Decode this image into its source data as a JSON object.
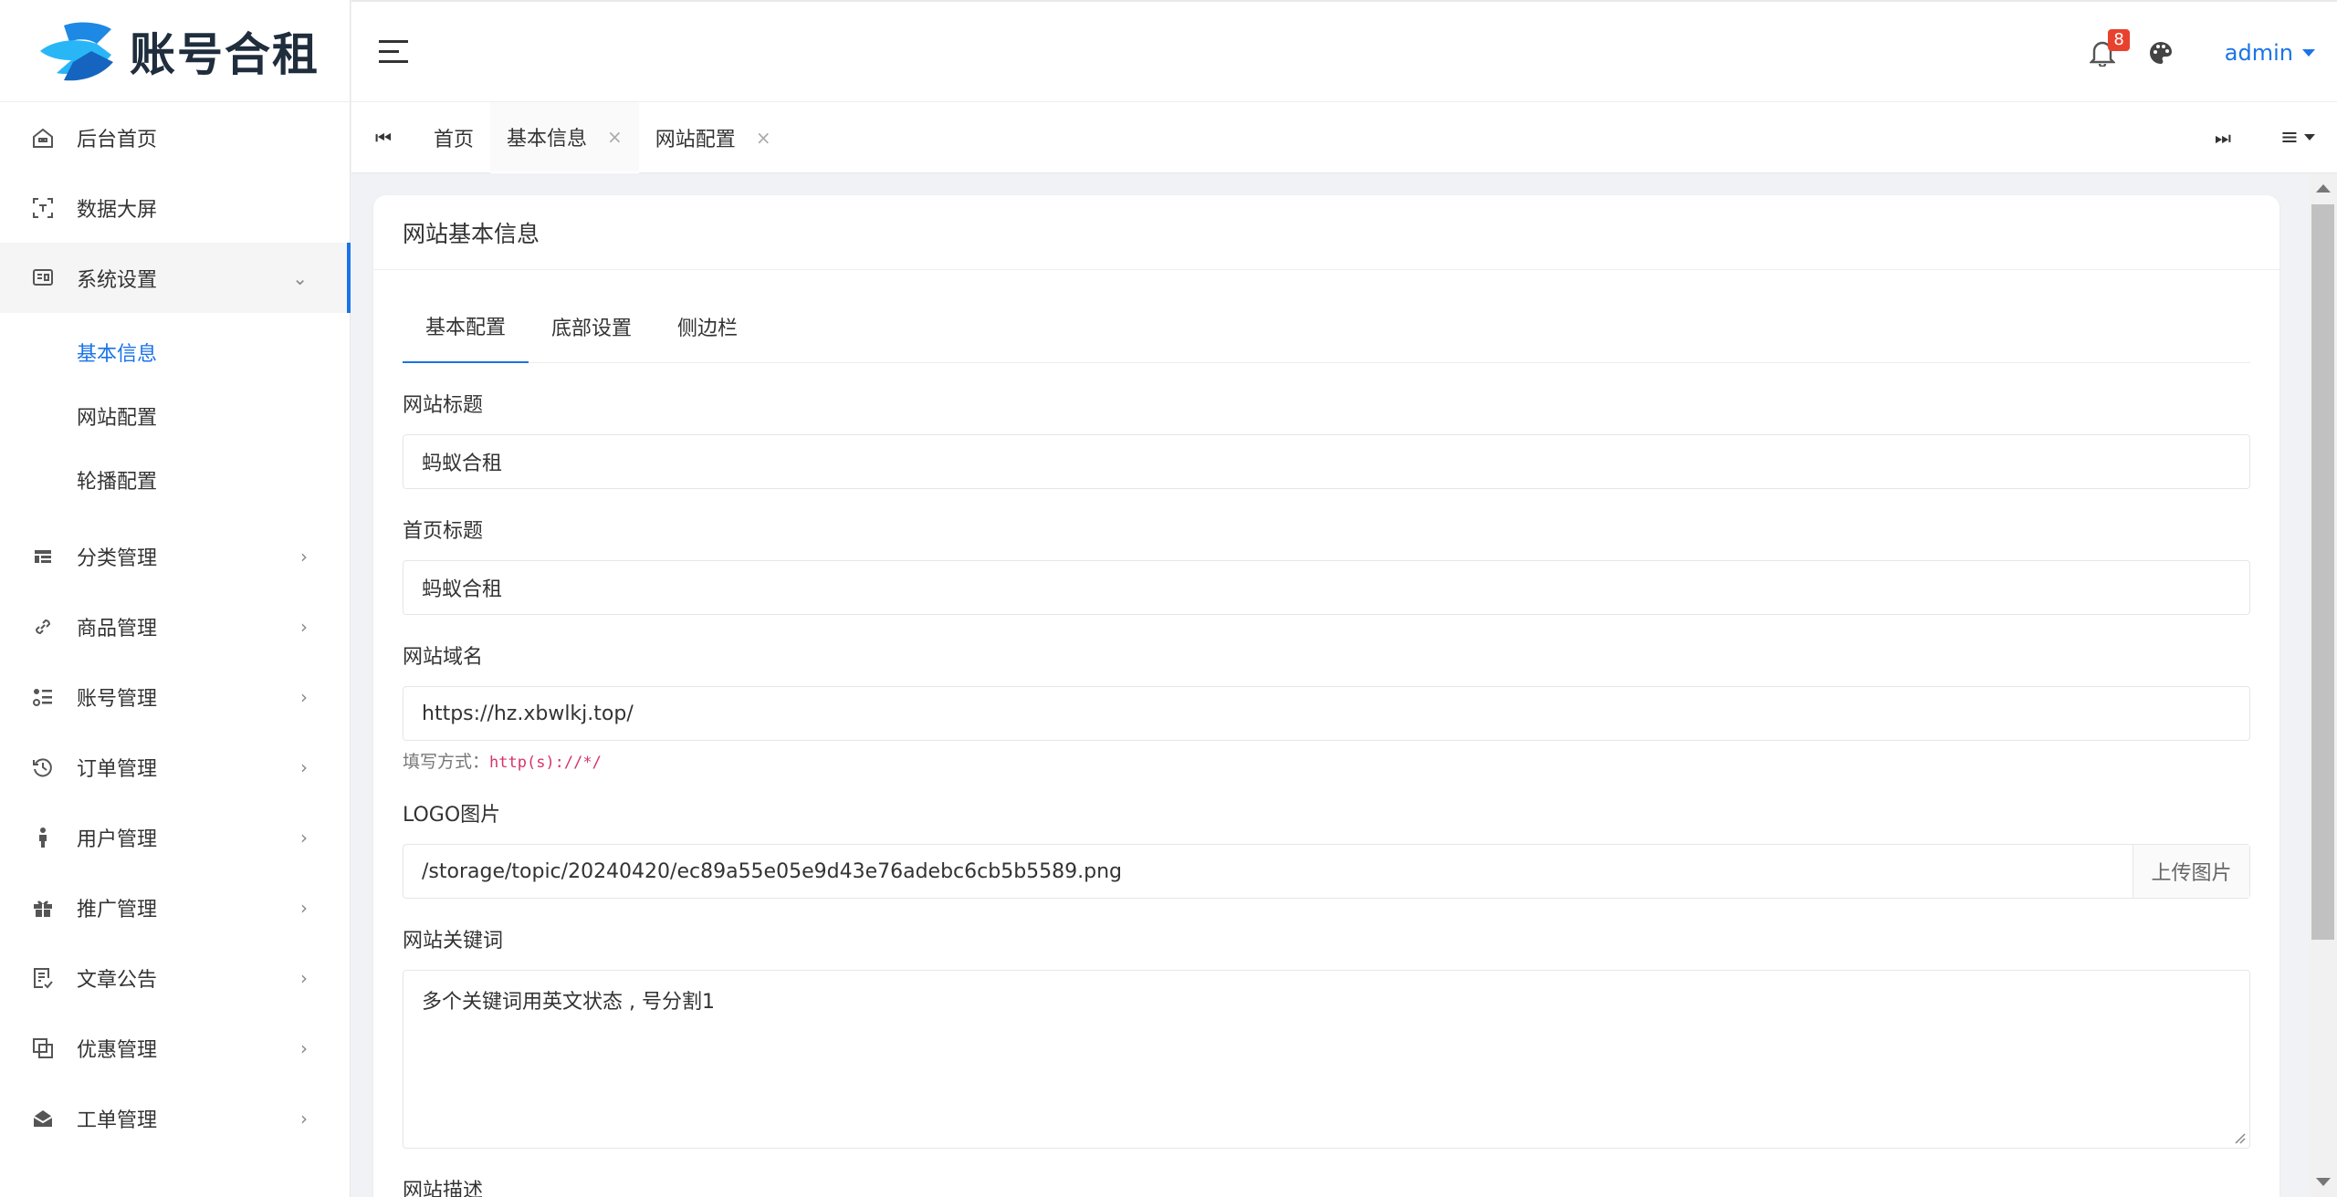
{
  "brand": {
    "name": "账号合租"
  },
  "sidebar": {
    "items": [
      {
        "label": "后台首页",
        "icon": "home-icon"
      },
      {
        "label": "数据大屏",
        "icon": "screen-icon"
      },
      {
        "label": "系统设置",
        "icon": "settings-icon",
        "expanded": true,
        "children": [
          {
            "label": "基本信息",
            "selected": true
          },
          {
            "label": "网站配置"
          },
          {
            "label": "轮播配置"
          }
        ]
      },
      {
        "label": "分类管理",
        "icon": "category-icon"
      },
      {
        "label": "商品管理",
        "icon": "link-icon"
      },
      {
        "label": "账号管理",
        "icon": "list-icon"
      },
      {
        "label": "订单管理",
        "icon": "history-icon"
      },
      {
        "label": "用户管理",
        "icon": "user-icon"
      },
      {
        "label": "推广管理",
        "icon": "gift-icon"
      },
      {
        "label": "文章公告",
        "icon": "article-icon"
      },
      {
        "label": "优惠管理",
        "icon": "coupon-icon"
      },
      {
        "label": "工单管理",
        "icon": "ticket-icon"
      }
    ]
  },
  "header": {
    "notification_count": "8",
    "user": "admin"
  },
  "tabs": [
    {
      "label": "首页",
      "closable": false
    },
    {
      "label": "基本信息",
      "closable": true,
      "current": true
    },
    {
      "label": "网站配置",
      "closable": true
    }
  ],
  "card": {
    "title": "网站基本信息",
    "form_tabs": [
      "基本配置",
      "底部设置",
      "侧边栏"
    ],
    "fields": {
      "site_title": {
        "label": "网站标题",
        "value": "蚂蚁合租"
      },
      "home_title": {
        "label": "首页标题",
        "value": "蚂蚁合租"
      },
      "domain": {
        "label": "网站域名",
        "value": "https://hz.xbwlkj.top/",
        "help_prefix": "填写方式：",
        "help_code": "http(s)://*/"
      },
      "logo": {
        "label": "LOGO图片",
        "value": "/storage/topic/20240420/ec89a55e05e9d43e76adebc6cb5b5589.png",
        "button": "上传图片"
      },
      "keywords": {
        "label": "网站关键词",
        "value": "多个关键词用英文状态 , 号分割1"
      },
      "description": {
        "label": "网站描述"
      }
    }
  },
  "colors": {
    "accent": "#1a73e8",
    "badge": "#e8422f",
    "code": "#d6336c"
  }
}
